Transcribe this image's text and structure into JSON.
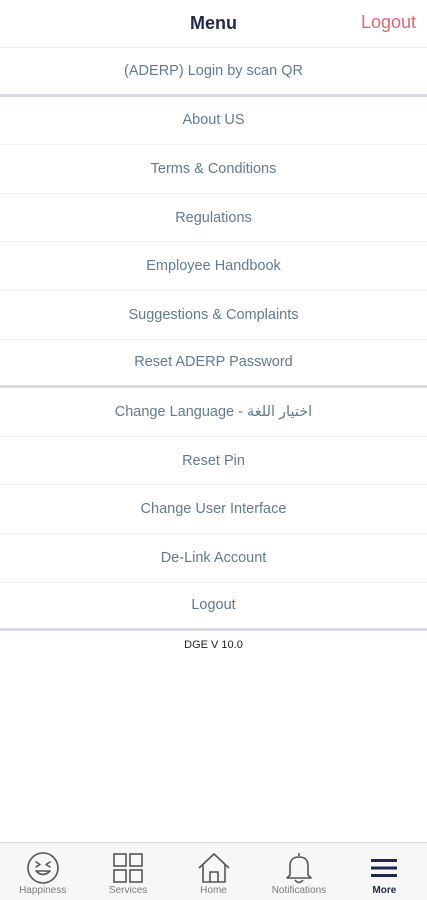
{
  "header": {
    "title": "Menu",
    "logout_label": "Logout"
  },
  "menu": [
    {
      "label": "(ADERP) Login by scan QR",
      "name": "menu-item-aderp-login-scan-qr"
    },
    {
      "label": "About US",
      "name": "menu-item-about-us"
    },
    {
      "label": "Terms & Conditions",
      "name": "menu-item-terms-conditions"
    },
    {
      "label": "Regulations",
      "name": "menu-item-regulations"
    },
    {
      "label": "Employee Handbook",
      "name": "menu-item-employee-handbook"
    },
    {
      "label": "Suggestions & Complaints",
      "name": "menu-item-suggestions-complaints"
    },
    {
      "label": "Reset ADERP Password",
      "name": "menu-item-reset-aderp-password"
    },
    {
      "label": "Change Language - اختيار اللغة",
      "name": "menu-item-change-language"
    },
    {
      "label": "Reset Pin",
      "name": "menu-item-reset-pin"
    },
    {
      "label": "Change User Interface",
      "name": "menu-item-change-user-interface"
    },
    {
      "label": "De-Link Account",
      "name": "menu-item-de-link-account"
    },
    {
      "label": "Logout",
      "name": "menu-item-logout"
    }
  ],
  "version": "DGE V 10.0",
  "tabs": [
    {
      "label": "Happiness",
      "icon": "smiley-icon",
      "active": false
    },
    {
      "label": "Services",
      "icon": "grid-icon",
      "active": false
    },
    {
      "label": "Home",
      "icon": "home-icon",
      "active": false
    },
    {
      "label": "Notifications",
      "icon": "bell-icon",
      "active": false
    },
    {
      "label": "More",
      "icon": "menu-icon",
      "active": true
    }
  ],
  "colors": {
    "accent": "#1c2a52",
    "logout": "#ea6470",
    "item_text": "#5d7c92"
  }
}
